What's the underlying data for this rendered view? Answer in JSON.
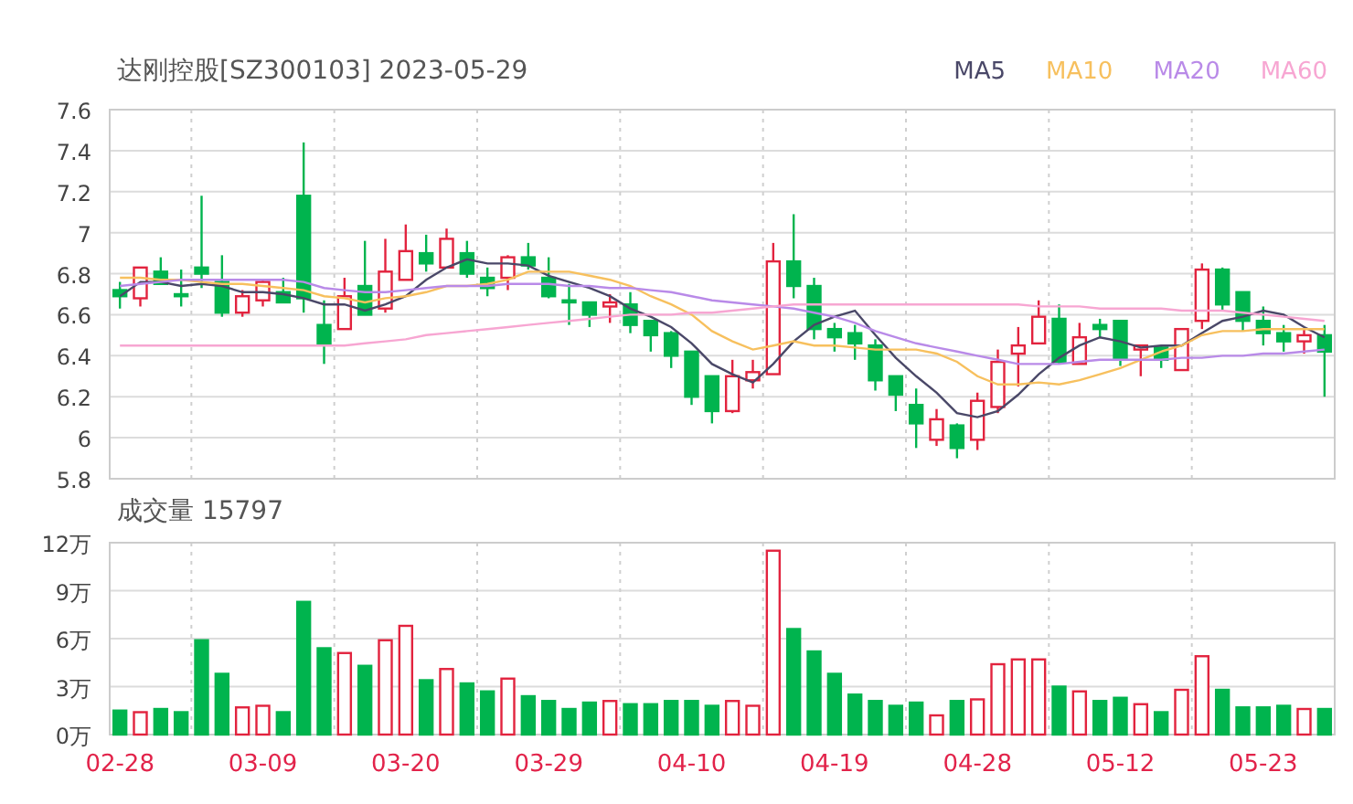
{
  "price_panel": {
    "chart_data": {
      "type": "candlestick",
      "title": "达刚控股[SZ300103] 2023-05-29",
      "grid": true,
      "ylim": [
        5.8,
        7.6
      ],
      "categories": [
        null,
        null,
        null,
        null,
        null,
        null,
        null,
        null,
        null,
        null,
        null,
        null,
        null,
        null,
        null,
        null,
        null,
        null,
        null,
        null,
        null,
        null,
        null,
        null,
        null,
        null,
        null,
        null,
        null,
        null,
        null,
        null,
        null,
        null,
        null,
        null,
        null,
        null,
        null,
        null,
        null,
        null,
        null,
        null,
        null,
        null,
        null,
        null,
        null,
        null,
        null,
        null,
        null,
        null,
        null,
        null,
        null,
        null,
        null,
        null
      ],
      "yticks": [
        {
          "value": 7.6,
          "label": "7.6"
        },
        {
          "value": 7.4,
          "label": "7.4"
        },
        {
          "value": 7.2,
          "label": "7.2"
        },
        {
          "value": 7,
          "label": "7"
        },
        {
          "value": 6.8,
          "label": "6.8"
        },
        {
          "value": 6.6,
          "label": "6.6"
        },
        {
          "value": 6.4,
          "label": "6.4"
        },
        {
          "value": 6.2,
          "label": "6.2"
        },
        {
          "value": 6,
          "label": "6"
        },
        {
          "value": 5.8,
          "label": "5.8"
        }
      ],
      "ohlc": [
        [
          6.72,
          6.76,
          6.63,
          6.69
        ],
        [
          6.68,
          6.83,
          6.64,
          6.83
        ],
        [
          6.81,
          6.88,
          6.75,
          6.75
        ],
        [
          6.7,
          6.82,
          6.64,
          6.69
        ],
        [
          6.83,
          7.18,
          6.73,
          6.8
        ],
        [
          6.76,
          6.89,
          6.59,
          6.61
        ],
        [
          6.61,
          6.72,
          6.59,
          6.69
        ],
        [
          6.67,
          6.77,
          6.64,
          6.76
        ],
        [
          6.71,
          6.78,
          6.66,
          6.66
        ],
        [
          7.18,
          7.44,
          6.61,
          6.68
        ],
        [
          6.55,
          6.67,
          6.36,
          6.46
        ],
        [
          6.53,
          6.78,
          6.53,
          6.69
        ],
        [
          6.74,
          6.96,
          6.6,
          6.6
        ],
        [
          6.63,
          6.97,
          6.61,
          6.81
        ],
        [
          6.77,
          7.04,
          6.77,
          6.91
        ],
        [
          6.9,
          6.99,
          6.81,
          6.85
        ],
        [
          6.83,
          7.02,
          6.83,
          6.97
        ],
        [
          6.9,
          6.96,
          6.78,
          6.8
        ],
        [
          6.78,
          6.83,
          6.69,
          6.73
        ],
        [
          6.78,
          6.89,
          6.72,
          6.88
        ],
        [
          6.88,
          6.95,
          6.82,
          6.84
        ],
        [
          6.78,
          6.88,
          6.68,
          6.69
        ],
        [
          6.67,
          6.75,
          6.55,
          6.66
        ],
        [
          6.66,
          6.66,
          6.54,
          6.6
        ],
        [
          6.64,
          6.7,
          6.56,
          6.66
        ],
        [
          6.65,
          6.71,
          6.51,
          6.55
        ],
        [
          6.57,
          6.57,
          6.42,
          6.5
        ],
        [
          6.51,
          6.52,
          6.34,
          6.4
        ],
        [
          6.42,
          6.42,
          6.16,
          6.2
        ],
        [
          6.3,
          6.3,
          6.07,
          6.13
        ],
        [
          6.13,
          6.38,
          6.12,
          6.3
        ],
        [
          6.28,
          6.38,
          6.24,
          6.32
        ],
        [
          6.31,
          6.95,
          6.31,
          6.86
        ],
        [
          6.86,
          7.09,
          6.68,
          6.74
        ],
        [
          6.74,
          6.78,
          6.48,
          6.53
        ],
        [
          6.53,
          6.56,
          6.42,
          6.49
        ],
        [
          6.51,
          6.55,
          6.38,
          6.46
        ],
        [
          6.45,
          6.48,
          6.23,
          6.28
        ],
        [
          6.3,
          6.3,
          6.13,
          6.21
        ],
        [
          6.16,
          6.24,
          5.95,
          6.07
        ],
        [
          5.99,
          6.14,
          5.96,
          6.09
        ],
        [
          6.06,
          6.07,
          5.9,
          5.95
        ],
        [
          5.99,
          6.22,
          5.94,
          6.18
        ],
        [
          6.15,
          6.43,
          6.12,
          6.37
        ],
        [
          6.41,
          6.54,
          6.25,
          6.45
        ],
        [
          6.46,
          6.67,
          6.46,
          6.59
        ],
        [
          6.58,
          6.65,
          6.36,
          6.37
        ],
        [
          6.36,
          6.56,
          6.36,
          6.49
        ],
        [
          6.55,
          6.58,
          6.49,
          6.53
        ],
        [
          6.57,
          6.57,
          6.35,
          6.38
        ],
        [
          6.43,
          6.45,
          6.3,
          6.45
        ],
        [
          6.44,
          6.45,
          6.34,
          6.38
        ],
        [
          6.33,
          6.53,
          6.33,
          6.53
        ],
        [
          6.57,
          6.85,
          6.53,
          6.82
        ],
        [
          6.82,
          6.83,
          6.62,
          6.65
        ],
        [
          6.71,
          6.71,
          6.52,
          6.57
        ],
        [
          6.57,
          6.64,
          6.45,
          6.51
        ],
        [
          6.51,
          6.55,
          6.42,
          6.47
        ],
        [
          6.47,
          6.53,
          6.41,
          6.5
        ],
        [
          6.5,
          6.55,
          6.2,
          6.42
        ]
      ],
      "series": [
        {
          "name": "MA5",
          "type": "line",
          "color": "#4a4868",
          "values": [
            6.69,
            6.76,
            6.76,
            6.74,
            6.75,
            6.74,
            6.71,
            6.71,
            6.7,
            6.68,
            6.65,
            6.65,
            6.62,
            6.65,
            6.69,
            6.77,
            6.83,
            6.87,
            6.85,
            6.85,
            6.84,
            6.79,
            6.76,
            6.73,
            6.69,
            6.63,
            6.59,
            6.54,
            6.46,
            6.36,
            6.31,
            6.27,
            6.36,
            6.47,
            6.55,
            6.59,
            6.62,
            6.5,
            6.39,
            6.3,
            6.22,
            6.12,
            6.1,
            6.13,
            6.21,
            6.31,
            6.39,
            6.45,
            6.49,
            6.47,
            6.44,
            6.45,
            6.45,
            6.51,
            6.57,
            6.59,
            6.62,
            6.6,
            6.54,
            6.49
          ]
        },
        {
          "name": "MA10",
          "type": "line",
          "color": "#f7c05e",
          "values": [
            6.78,
            6.78,
            6.77,
            6.77,
            6.76,
            6.75,
            6.75,
            6.74,
            6.73,
            6.72,
            6.69,
            6.68,
            6.66,
            6.68,
            6.69,
            6.71,
            6.74,
            6.74,
            6.75,
            6.77,
            6.81,
            6.81,
            6.81,
            6.79,
            6.77,
            6.74,
            6.69,
            6.65,
            6.6,
            6.52,
            6.47,
            6.43,
            6.45,
            6.47,
            6.45,
            6.45,
            6.44,
            6.43,
            6.43,
            6.43,
            6.41,
            6.37,
            6.3,
            6.26,
            6.26,
            6.27,
            6.26,
            6.28,
            6.31,
            6.34,
            6.38,
            6.42,
            6.45,
            6.5,
            6.52,
            6.52,
            6.53,
            6.53,
            6.53,
            6.53
          ]
        },
        {
          "name": "MA20",
          "type": "line",
          "color": "#b98ae8",
          "values": [
            6.74,
            6.75,
            6.76,
            6.77,
            6.77,
            6.77,
            6.77,
            6.77,
            6.77,
            6.76,
            6.73,
            6.72,
            6.71,
            6.71,
            6.72,
            6.73,
            6.74,
            6.74,
            6.74,
            6.75,
            6.75,
            6.75,
            6.74,
            6.74,
            6.73,
            6.73,
            6.72,
            6.71,
            6.69,
            6.67,
            6.66,
            6.65,
            6.64,
            6.63,
            6.61,
            6.59,
            6.56,
            6.52,
            6.49,
            6.46,
            6.44,
            6.42,
            6.4,
            6.38,
            6.36,
            6.36,
            6.36,
            6.37,
            6.38,
            6.38,
            6.38,
            6.38,
            6.39,
            6.39,
            6.4,
            6.4,
            6.41,
            6.41,
            6.42,
            6.43
          ]
        },
        {
          "name": "MA60",
          "type": "line",
          "color": "#f7a6d2",
          "values": [
            6.45,
            6.45,
            6.45,
            6.45,
            6.45,
            6.45,
            6.45,
            6.45,
            6.45,
            6.45,
            6.45,
            6.45,
            6.46,
            6.47,
            6.48,
            6.5,
            6.51,
            6.52,
            6.53,
            6.54,
            6.55,
            6.56,
            6.57,
            6.58,
            6.59,
            6.6,
            6.6,
            6.6,
            6.61,
            6.61,
            6.62,
            6.63,
            6.64,
            6.65,
            6.65,
            6.65,
            6.65,
            6.65,
            6.65,
            6.65,
            6.65,
            6.65,
            6.65,
            6.65,
            6.65,
            6.64,
            6.64,
            6.64,
            6.63,
            6.63,
            6.63,
            6.63,
            6.62,
            6.62,
            6.62,
            6.61,
            6.6,
            6.59,
            6.58,
            6.57
          ]
        }
      ]
    }
  },
  "volume_panel": {
    "chart_data": {
      "type": "bar",
      "title": "成交量 15797",
      "grid": true,
      "ylim": [
        0,
        12
      ],
      "categories": [
        "02-28",
        null,
        null,
        null,
        null,
        null,
        null,
        "03-09",
        null,
        null,
        null,
        null,
        null,
        null,
        "03-20",
        null,
        null,
        null,
        null,
        null,
        null,
        "03-29",
        null,
        null,
        null,
        null,
        null,
        null,
        "04-10",
        null,
        null,
        null,
        null,
        null,
        null,
        "04-19",
        null,
        null,
        null,
        null,
        null,
        null,
        "04-28",
        null,
        null,
        null,
        null,
        null,
        null,
        "05-12",
        null,
        null,
        null,
        null,
        null,
        null,
        "05-23",
        null,
        null,
        null
      ],
      "yticks": [
        {
          "value": 12,
          "label": "12万"
        },
        {
          "value": 9,
          "label": "9万"
        },
        {
          "value": 6,
          "label": "6万"
        },
        {
          "value": 3,
          "label": "3万"
        },
        {
          "value": 0,
          "label": "0万"
        }
      ],
      "values": [
        1.5,
        1.4,
        1.6,
        1.4,
        5.9,
        3.8,
        1.7,
        1.8,
        1.4,
        8.3,
        5.4,
        5.1,
        4.3,
        5.9,
        6.8,
        3.4,
        4.1,
        3.2,
        2.7,
        3.5,
        2.4,
        2.1,
        1.6,
        2.0,
        2.1,
        1.9,
        1.9,
        2.1,
        2.1,
        1.8,
        2.1,
        1.8,
        11.5,
        6.6,
        5.2,
        3.8,
        2.5,
        2.1,
        1.8,
        2.0,
        1.2,
        2.1,
        2.2,
        4.4,
        4.7,
        4.7,
        3.0,
        2.7,
        2.1,
        2.3,
        1.9,
        1.4,
        2.8,
        4.9,
        2.8,
        1.7,
        1.7,
        1.8,
        1.6,
        1.6
      ]
    }
  }
}
